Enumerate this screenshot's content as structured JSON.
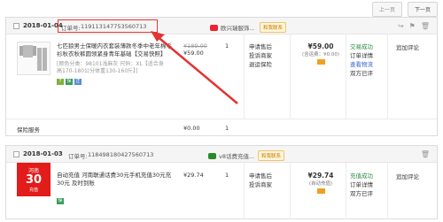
{
  "pager": {
    "prev": "上一页",
    "next": "下一页"
  },
  "colors": {
    "accent": "#e33333",
    "status_green": "#2b8a3e",
    "link_blue": "#3366cc"
  },
  "orders": [
    {
      "date": "2018-01-04",
      "order_label": "订单号:",
      "order_no": "119113147753560713",
      "shop_name": "欧兴瑞服饰...",
      "contact": "和我联系",
      "item": {
        "title": "七匹狼男士保暖内衣套装薄款冬季中老年棉毛衫秋衣秋裤圆领紧身青年基础【交易快照】",
        "meta": "[颜色分类：98101浅麻灰 尺码：XL【适合身高170-180公分体重130-160斤】]",
        "orig_price": "¥189.00",
        "price": "¥59.00",
        "qty": "1",
        "services": [
          "申请售后",
          "投诉商家",
          "退运保险"
        ],
        "total": "¥59.00",
        "total_note": "(含运费：¥0.00)",
        "status": [
          "交易成功",
          "订单详情",
          "查看物流",
          "双方已评"
        ],
        "action": "追加评论"
      },
      "insurance": {
        "label": "保险服务",
        "amount": "¥0.00",
        "qty": "1"
      }
    },
    {
      "date": "2018-01-03",
      "order_label": "订单号:",
      "order_no": "118498180427560713",
      "shop_name": "v8话费充值...",
      "contact": "和我联系",
      "item": {
        "logo_line1": "河南",
        "logo_line2": "30",
        "logo_line3": "充值",
        "title": "自动充值 河南联通话费30元手机充值30元充30元 及时到账",
        "price": "¥29.74",
        "qty": "1",
        "services": [
          "申请售后",
          "投诉商家"
        ],
        "total": "¥29.74",
        "total_note": "(自动充值)",
        "status": [
          "充值成功",
          "订单详情",
          "双方已评"
        ],
        "action": "追加评论"
      }
    }
  ]
}
